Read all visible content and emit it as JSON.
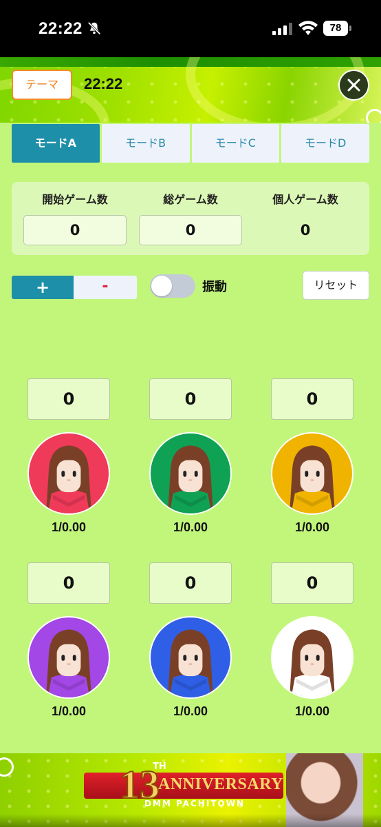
{
  "status_bar": {
    "time": "22:22",
    "battery": "78",
    "icons": [
      "bell-slash-icon",
      "signal-icon",
      "wifi-icon",
      "battery-icon"
    ]
  },
  "header": {
    "theme_button": "テーマ",
    "time": "22:22",
    "close_icon": "close-icon"
  },
  "tabs": [
    {
      "label": "モードA",
      "active": true
    },
    {
      "label": "モードB",
      "active": false
    },
    {
      "label": "モードC",
      "active": false
    },
    {
      "label": "モードD",
      "active": false
    }
  ],
  "counters": {
    "start_games": {
      "label": "開始ゲーム数",
      "value": "0"
    },
    "total_games": {
      "label": "総ゲーム数",
      "value": "0"
    },
    "personal_games": {
      "label": "個人ゲーム数",
      "value": "0"
    }
  },
  "controls": {
    "plus": "+",
    "minus": "-",
    "vibration_label": "振動",
    "vibration_on": false,
    "reset": "リセット"
  },
  "players": [
    {
      "score": "0",
      "rate": "1/0.00",
      "color": "#f03a5a",
      "shirt": "#f03a5a"
    },
    {
      "score": "0",
      "rate": "1/0.00",
      "color": "#0fa154",
      "shirt": "#0fa154"
    },
    {
      "score": "0",
      "rate": "1/0.00",
      "color": "#f0b400",
      "shirt": "#f0b400"
    },
    {
      "score": "0",
      "rate": "1/0.00",
      "color": "#a347e6",
      "shirt": "#a347e6"
    },
    {
      "score": "0",
      "rate": "1/0.00",
      "color": "#2f5fe6",
      "shirt": "#2f5fe6"
    },
    {
      "score": "0",
      "rate": "1/0.00",
      "color": "#ffffff",
      "shirt": "#ffffff"
    }
  ],
  "banner": {
    "number": "13",
    "suffix": "TH",
    "title": "ANNIVERSARY",
    "brand": "DMM PACHITOWN"
  },
  "colors": {
    "accent": "#1e8fa8",
    "background": "#c2f67b",
    "theme_border": "#f28c28"
  }
}
